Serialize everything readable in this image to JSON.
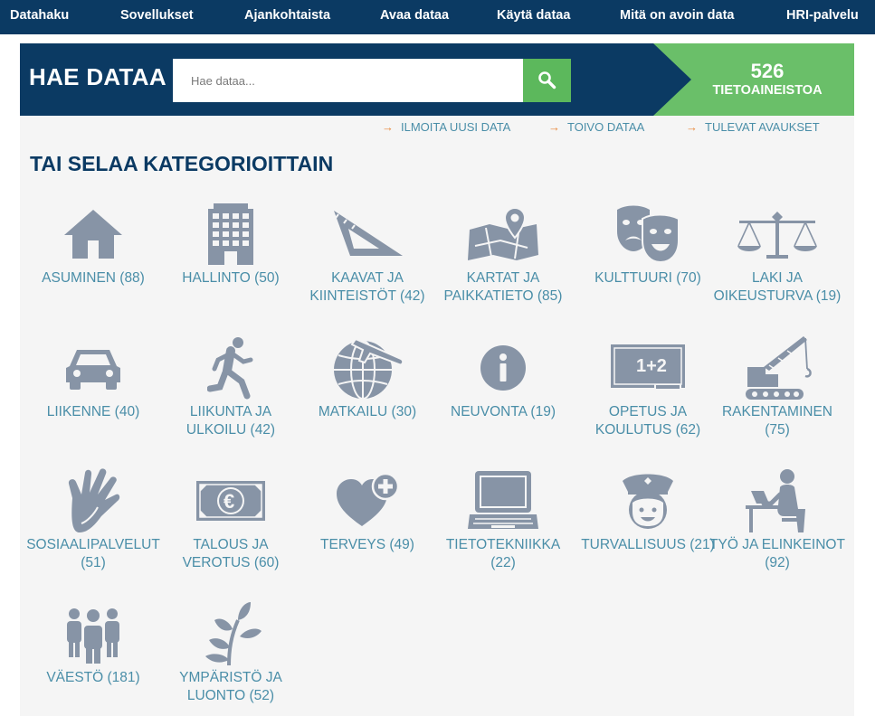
{
  "topnav": {
    "items": [
      "Datahaku",
      "Sovellukset",
      "Ajankohtaista",
      "Avaa dataa",
      "Käytä dataa",
      "Mitä on avoin data",
      "HRI-palvelu"
    ]
  },
  "hero": {
    "title": "HAE DATAA",
    "search_placeholder": "Hae dataa...",
    "search_icon": "search-icon",
    "count": "526",
    "count_label": "TIETOAINEISTOA"
  },
  "sublinks": [
    "ILMOITA UUSI DATA",
    "TOIVO DATAA",
    "TULEVAT AVAUKSET"
  ],
  "section_title": "TAI SELAA KATEGORIOITTAIN",
  "colors": {
    "navy": "#0b3a63",
    "green": "#5cb85c",
    "count_green": "#6abf69",
    "link_blue": "#4a8ea8",
    "icon_gray": "#8794a6",
    "arrow_orange": "#e8883a"
  },
  "categories": [
    {
      "label": "ASUMINEN (88)",
      "icon": "house-icon"
    },
    {
      "label": "HALLINTO (50)",
      "icon": "office-building-icon"
    },
    {
      "label": "KAAVAT JA KIINTEISTÖT (42)",
      "icon": "set-square-icon"
    },
    {
      "label": "KARTAT JA PAIKKATIETO (85)",
      "icon": "map-pin-icon"
    },
    {
      "label": "KULTTUURI (70)",
      "icon": "theater-masks-icon"
    },
    {
      "label": "LAKI JA OIKEUSTURVA (19)",
      "icon": "scales-icon"
    },
    {
      "label": "LIIKENNE (40)",
      "icon": "car-icon"
    },
    {
      "label": "LIIKUNTA JA ULKOILU (42)",
      "icon": "runner-icon"
    },
    {
      "label": "MATKAILU (30)",
      "icon": "globe-plane-icon"
    },
    {
      "label": "NEUVONTA (19)",
      "icon": "info-icon"
    },
    {
      "label": "OPETUS JA KOULUTUS (62)",
      "icon": "blackboard-icon"
    },
    {
      "label": "RAKENTAMINEN (75)",
      "icon": "crane-icon"
    },
    {
      "label": "SOSIAALIPALVELUT (51)",
      "icon": "hand-icon"
    },
    {
      "label": "TALOUS JA VEROTUS (60)",
      "icon": "euro-banknote-icon"
    },
    {
      "label": "TERVEYS (49)",
      "icon": "heart-plus-icon"
    },
    {
      "label": "TIETOTEKNIIKKA (22)",
      "icon": "laptop-icon"
    },
    {
      "label": "TURVALLISUUS (21)",
      "icon": "police-officer-icon"
    },
    {
      "label": "TYÖ JA ELINKEINOT (92)",
      "icon": "person-at-desk-icon"
    },
    {
      "label": "VÄESTÖ (181)",
      "icon": "population-icon"
    },
    {
      "label": "YMPÄRISTÖ JA LUONTO (52)",
      "icon": "plant-icon"
    }
  ]
}
